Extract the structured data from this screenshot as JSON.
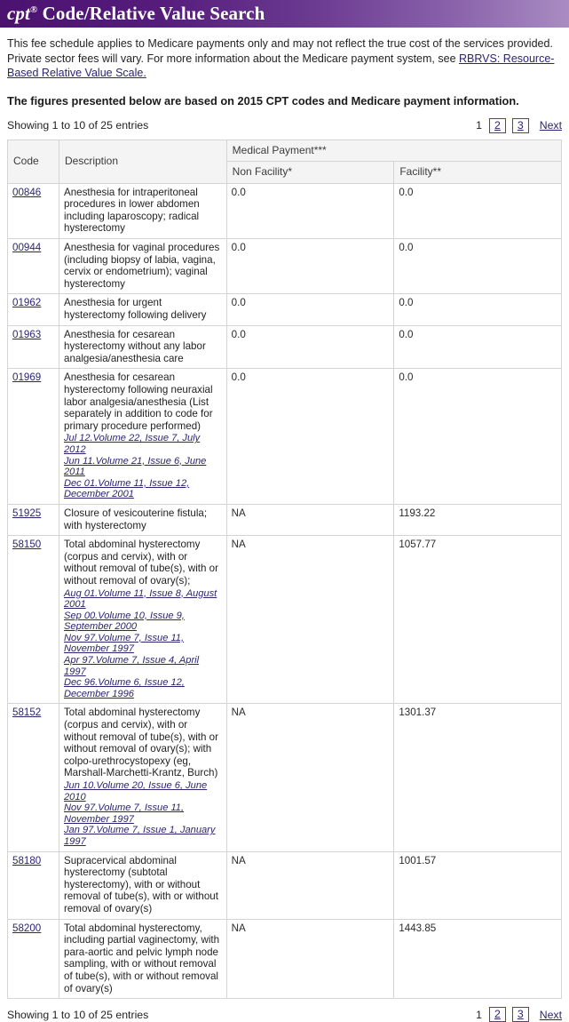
{
  "banner": {
    "brand": "cpt",
    "registered_mark": "®",
    "title": " Code/Relative Value Search"
  },
  "intro": {
    "text_before_link": "This fee schedule applies to Medicare payments only and may not reflect the true cost of the services provided. Private sector fees will vary. For more information about the Medicare payment system, see ",
    "link_text": "RBRVS: Resource-Based Relative Value Scale.",
    "headline": "The figures presented below are based on 2015 CPT codes and Medicare payment information."
  },
  "top_bar": {
    "showing": "Showing 1 to 10 of 25 entries",
    "current_page": "1",
    "page_links": [
      "2",
      "3"
    ],
    "next_label": "Next"
  },
  "bottom_bar": {
    "showing": "Showing 1 to 10 of 25 entries",
    "current_page": "1",
    "page_links": [
      "2",
      "3"
    ],
    "next_label": "Next"
  },
  "table": {
    "headers": {
      "code": "Code",
      "description": "Description",
      "medical_payment": "Medical Payment***",
      "non_facility": "Non Facility*",
      "facility": "Facility**"
    },
    "rows": [
      {
        "code": "00846",
        "description": "Anesthesia for intraperitoneal procedures in lower abdomen including laparoscopy; radical hysterectomy",
        "citations": [],
        "non_facility": "0.0",
        "facility": "0.0"
      },
      {
        "code": "00944",
        "description": "Anesthesia for vaginal procedures (including biopsy of labia, vagina, cervix or endometrium); vaginal hysterectomy",
        "citations": [],
        "non_facility": "0.0",
        "facility": "0.0"
      },
      {
        "code": "01962",
        "description": "Anesthesia for urgent hysterectomy following delivery",
        "citations": [],
        "non_facility": "0.0",
        "facility": "0.0"
      },
      {
        "code": "01963",
        "description": "Anesthesia for cesarean hysterectomy without any labor analgesia/anesthesia care",
        "citations": [],
        "non_facility": "0.0",
        "facility": "0.0"
      },
      {
        "code": "01969",
        "description": "Anesthesia for cesarean hysterectomy following neuraxial labor analgesia/anesthesia (List separately in addition to code for primary procedure performed)",
        "citations": [
          "Jul 12.Volume 22, Issue 7, July 2012",
          "Jun 11.Volume 21, Issue 6, June 2011",
          "Dec 01.Volume 11, Issue 12, December 2001"
        ],
        "non_facility": "0.0",
        "facility": "0.0"
      },
      {
        "code": "51925",
        "description": "Closure of vesicouterine fistula; with hysterectomy",
        "citations": [],
        "non_facility": "NA",
        "facility": "1193.22"
      },
      {
        "code": "58150",
        "description": "Total abdominal hysterectomy (corpus and cervix), with or without removal of tube(s), with or without removal of ovary(s);",
        "citations": [
          "Aug 01.Volume 11, Issue 8, August 2001",
          "Sep 00.Volume 10, Issue 9, September 2000",
          "Nov 97.Volume 7, Issue 11, November 1997",
          "Apr 97.Volume 7, Issue 4, April 1997",
          "Dec 96.Volume 6, Issue 12, December 1996"
        ],
        "non_facility": "NA",
        "facility": "1057.77"
      },
      {
        "code": "58152",
        "description": "Total abdominal hysterectomy (corpus and cervix), with or without removal of tube(s), with or without removal of ovary(s); with colpo-urethrocystopexy (eg, Marshall-Marchetti-Krantz, Burch)",
        "citations": [
          "Jun 10.Volume 20, Issue 6, June 2010",
          "Nov 97.Volume 7, Issue 11, November 1997",
          "Jan 97.Volume 7, Issue 1, January 1997"
        ],
        "non_facility": "NA",
        "facility": "1301.37"
      },
      {
        "code": "58180",
        "description": "Supracervical abdominal hysterectomy (subtotal hysterectomy), with or without removal of tube(s), with or without removal of ovary(s)",
        "citations": [],
        "non_facility": "NA",
        "facility": "1001.57"
      },
      {
        "code": "58200",
        "description": "Total abdominal hysterectomy, including partial vaginectomy, with para-aortic and pelvic lymph node sampling, with or without removal of tube(s), with or without removal of ovary(s)",
        "citations": [],
        "non_facility": "NA",
        "facility": "1443.85"
      }
    ]
  },
  "colors": {
    "banner_dark": "#4b1270",
    "banner_light": "#a98cc2",
    "link": "#2c2470",
    "header_bg": "#f4f4f4",
    "border": "#d4d4d4"
  }
}
